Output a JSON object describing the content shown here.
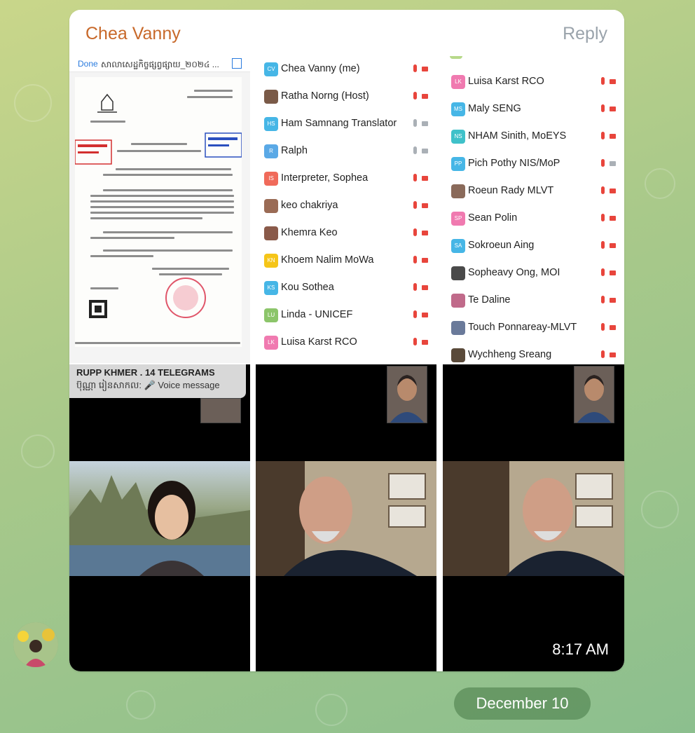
{
  "message": {
    "sender": "Chea Vanny",
    "reply_label": "Reply",
    "timestamp": "8:17 AM"
  },
  "document": {
    "done_label": "Done",
    "title": "សាលាសេដ្ឋកិច្ចផ្សព្វផ្សាយ_២០២៤ ..."
  },
  "participants_col1": [
    {
      "initials": "CV",
      "name": "Chea Vanny (me)",
      "color": "#46b6e6",
      "mic": "muted",
      "cam": "off"
    },
    {
      "initials": "",
      "name": "Ratha Norng (Host)",
      "color": "#7a5a48",
      "mic": "muted",
      "cam": "off"
    },
    {
      "initials": "HS",
      "name": "Ham Samnang Translator",
      "color": "#46b6e6",
      "mic": "on",
      "cam": "on"
    },
    {
      "initials": "R",
      "name": "Ralph",
      "color": "#5aa9e6",
      "mic": "on",
      "cam": "on"
    },
    {
      "initials": "IS",
      "name": "Interpreter, Sophea",
      "color": "#f06a5a",
      "mic": "muted",
      "cam": "off"
    },
    {
      "initials": "",
      "name": "keo chakriya",
      "color": "#9a6b55",
      "mic": "muted",
      "cam": "off"
    },
    {
      "initials": "",
      "name": "Khemra Keo",
      "color": "#8a5a4a",
      "mic": "muted",
      "cam": "off"
    },
    {
      "initials": "KN",
      "name": "Khoem Nalim MoWa",
      "color": "#f5c518",
      "mic": "muted",
      "cam": "off"
    },
    {
      "initials": "KS",
      "name": "Kou Sothea",
      "color": "#46b6e6",
      "mic": "muted",
      "cam": "off"
    },
    {
      "initials": "LU",
      "name": "Linda - UNICEF",
      "color": "#8cc56a",
      "mic": "muted",
      "cam": "off"
    },
    {
      "initials": "LK",
      "name": "Luisa Karst RCO",
      "color": "#f07ab0",
      "mic": "muted",
      "cam": "off"
    }
  ],
  "participants_col2": [
    {
      "initials": "LK",
      "name": "Luisa Karst RCO",
      "color": "#f07ab0",
      "mic": "muted",
      "cam": "off"
    },
    {
      "initials": "MS",
      "name": "Maly SENG",
      "color": "#46b6e6",
      "mic": "muted",
      "cam": "off"
    },
    {
      "initials": "NS",
      "name": "NHAM Sinith, MoEYS",
      "color": "#3fc1c9",
      "mic": "muted",
      "cam": "off"
    },
    {
      "initials": "PP",
      "name": "Pich Pothy NIS/MoP",
      "color": "#46b6e6",
      "mic": "muted",
      "cam": "on"
    },
    {
      "initials": "",
      "name": "Roeun Rady MLVT",
      "color": "#8a6a5a",
      "mic": "muted",
      "cam": "off"
    },
    {
      "initials": "SP",
      "name": "Sean Polin",
      "color": "#f07ab0",
      "mic": "muted",
      "cam": "off"
    },
    {
      "initials": "SA",
      "name": "Sokroeun Aing",
      "color": "#46b6e6",
      "mic": "muted",
      "cam": "off"
    },
    {
      "initials": "",
      "name": "Sopheavy Ong, MOI",
      "color": "#4a4a4a",
      "mic": "muted",
      "cam": "off"
    },
    {
      "initials": "",
      "name": "Te Daline",
      "color": "#c06a8a",
      "mic": "muted",
      "cam": "off"
    },
    {
      "initials": "",
      "name": "Touch Ponnareay-MLVT",
      "color": "#6a7a9a",
      "mic": "muted",
      "cam": "off"
    },
    {
      "initials": "",
      "name": "Wychheng Sreang",
      "color": "#5a4a3a",
      "mic": "muted",
      "cam": "off"
    }
  ],
  "notification": {
    "title": "RUPP KHMER . 14 TELEGRAMS",
    "body": "ប៊ុណ្ណា រៀនសាកល: 🎤 Voice message"
  },
  "date_separator": "December 10",
  "colors": {
    "sender_name": "#c8692a",
    "muted_icon": "#e8453c",
    "link_blue": "#2a7bde"
  }
}
